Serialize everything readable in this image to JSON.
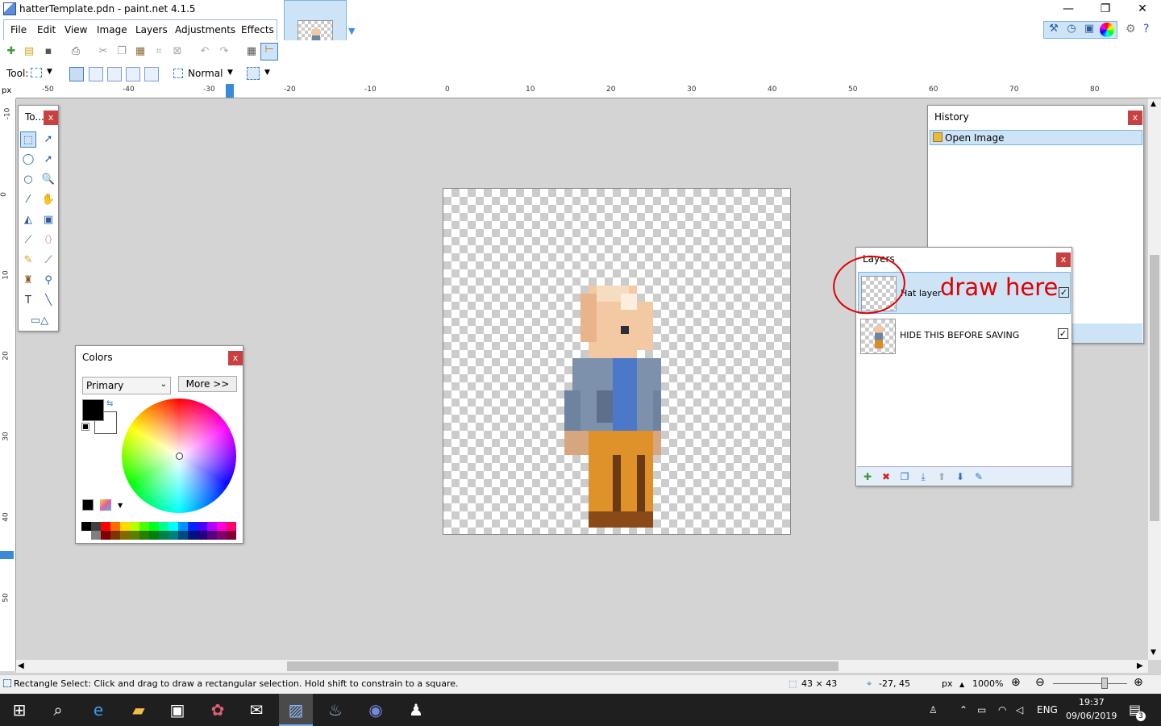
{
  "window": {
    "title": "hatterTemplate.pdn - paint.net 4.1.5",
    "minimize": "—",
    "maximize": "❐",
    "close": "✕"
  },
  "menu": {
    "items": [
      "File",
      "Edit",
      "View",
      "Image",
      "Layers",
      "Adjustments",
      "Effects"
    ]
  },
  "toolbar": {
    "tool_label": "Tool:",
    "blend_mode": "Normal"
  },
  "rulers": {
    "unit": "px",
    "top_ticks": [
      "-50",
      "-40",
      "-30",
      "-20",
      "-10",
      "0",
      "10",
      "20",
      "30",
      "40",
      "50",
      "60",
      "70",
      "80"
    ],
    "left_ticks": [
      "-10",
      "0",
      "10",
      "20",
      "30",
      "40",
      "50"
    ]
  },
  "tools_panel": {
    "title": "To...",
    "close": "x"
  },
  "colors_panel": {
    "title": "Colors",
    "close": "x",
    "mode": "Primary",
    "more_button": "More >>",
    "primary_color": "#000000",
    "secondary_color": "#ffffff"
  },
  "palette": [
    "#000000",
    "#404040",
    "#ff0000",
    "#ff6a00",
    "#ffd800",
    "#b6ff00",
    "#4cff00",
    "#00ff21",
    "#00ff90",
    "#00ffff",
    "#0094ff",
    "#0026ff",
    "#4800ff",
    "#b200ff",
    "#ff00dc",
    "#ff006e",
    "#ffffff",
    "#808080",
    "#7f0000",
    "#7f3300",
    "#7f6a00",
    "#5b7f00",
    "#267f00",
    "#007f0e",
    "#007f46",
    "#007f7f",
    "#004a7f",
    "#00137f",
    "#21007f",
    "#57007f",
    "#7f006e",
    "#7f0037"
  ],
  "history_panel": {
    "title": "History",
    "close": "x",
    "items": [
      "Open Image"
    ]
  },
  "layers_panel": {
    "title": "Layers",
    "close": "x",
    "layers": [
      {
        "name": "Hat layer",
        "visible": true,
        "selected": true
      },
      {
        "name": "HIDE THIS BEFORE SAVING",
        "visible": true,
        "selected": false
      }
    ]
  },
  "annotation": {
    "text": "draw here",
    "color": "#e00000"
  },
  "status": {
    "hint": "Rectangle Select: Click and drag to draw a rectangular selection. Hold shift to constrain to a square.",
    "selection_size": "43 × 43",
    "cursor_pos": "-27, 45",
    "unit": "px",
    "zoom": "1000%"
  },
  "taskbar": {
    "language": "ENG",
    "time": "19:37",
    "date": "09/06/2019",
    "notifications": "3"
  },
  "colors": {
    "accent": "#3a8ad8",
    "selection_bg": "#cde4f7"
  }
}
